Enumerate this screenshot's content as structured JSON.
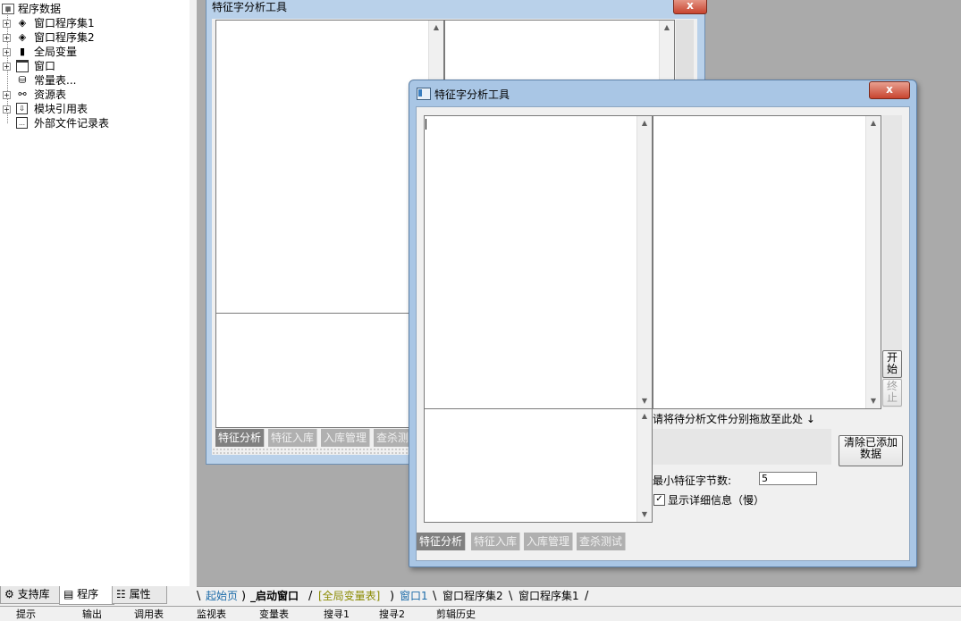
{
  "tree": {
    "root": "程序数据",
    "items": [
      {
        "label": "窗口程序集1",
        "icon": "stack-icon",
        "expander": "+"
      },
      {
        "label": "窗口程序集2",
        "icon": "stack-icon",
        "expander": "+"
      },
      {
        "label": "全局变量",
        "icon": "variable-icon",
        "expander": "+"
      },
      {
        "label": "窗口",
        "icon": "window-icon",
        "expander": "+"
      },
      {
        "label": "常量表...",
        "icon": "constant-icon",
        "expander": ""
      },
      {
        "label": "资源表",
        "icon": "resource-icon",
        "expander": "+"
      },
      {
        "label": "模块引用表",
        "icon": "module-icon",
        "expander": "+"
      },
      {
        "label": "外部文件记录表",
        "icon": "file-icon",
        "expander": ""
      }
    ]
  },
  "left_tabs": [
    {
      "label": "支持库"
    },
    {
      "label": "程序"
    },
    {
      "label": "属性"
    }
  ],
  "bg_window": {
    "title": "特征字分析工具",
    "tabs": [
      "特征分析",
      "特征入库",
      "入库管理",
      "查杀测试"
    ]
  },
  "dialog": {
    "title": "特征字分析工具",
    "close_label": "x",
    "start_label": "开始",
    "stop_label": "终止",
    "drop_hint": "请将待分析文件分别拖放至此处 ↓",
    "clear_label": "清除已添加数据",
    "min_bytes_label": "最小特征字节数:",
    "min_bytes_value": "5",
    "show_detail_label": "显示详细信息（慢）",
    "show_detail_checked": "✓",
    "tabs": [
      "特征分析",
      "特征入库",
      "入库管理",
      "查杀测试"
    ]
  },
  "doc_tabs": [
    {
      "label": "起始页",
      "color": "#1a6aa8"
    },
    {
      "label": "_启动窗口",
      "color": "#000000"
    },
    {
      "label": "[全局变量表]",
      "color": "#8a8a00"
    },
    {
      "label": "窗口1",
      "color": "#1a6aa8"
    },
    {
      "label": "窗口程序集2",
      "color": "#000000"
    },
    {
      "label": "窗口程序集1",
      "color": "#000000"
    }
  ],
  "bottom_row": [
    "提示",
    "输出",
    "调用表",
    "监视表",
    "变量表",
    "搜寻1",
    "搜寻2",
    "剪辑历史"
  ]
}
